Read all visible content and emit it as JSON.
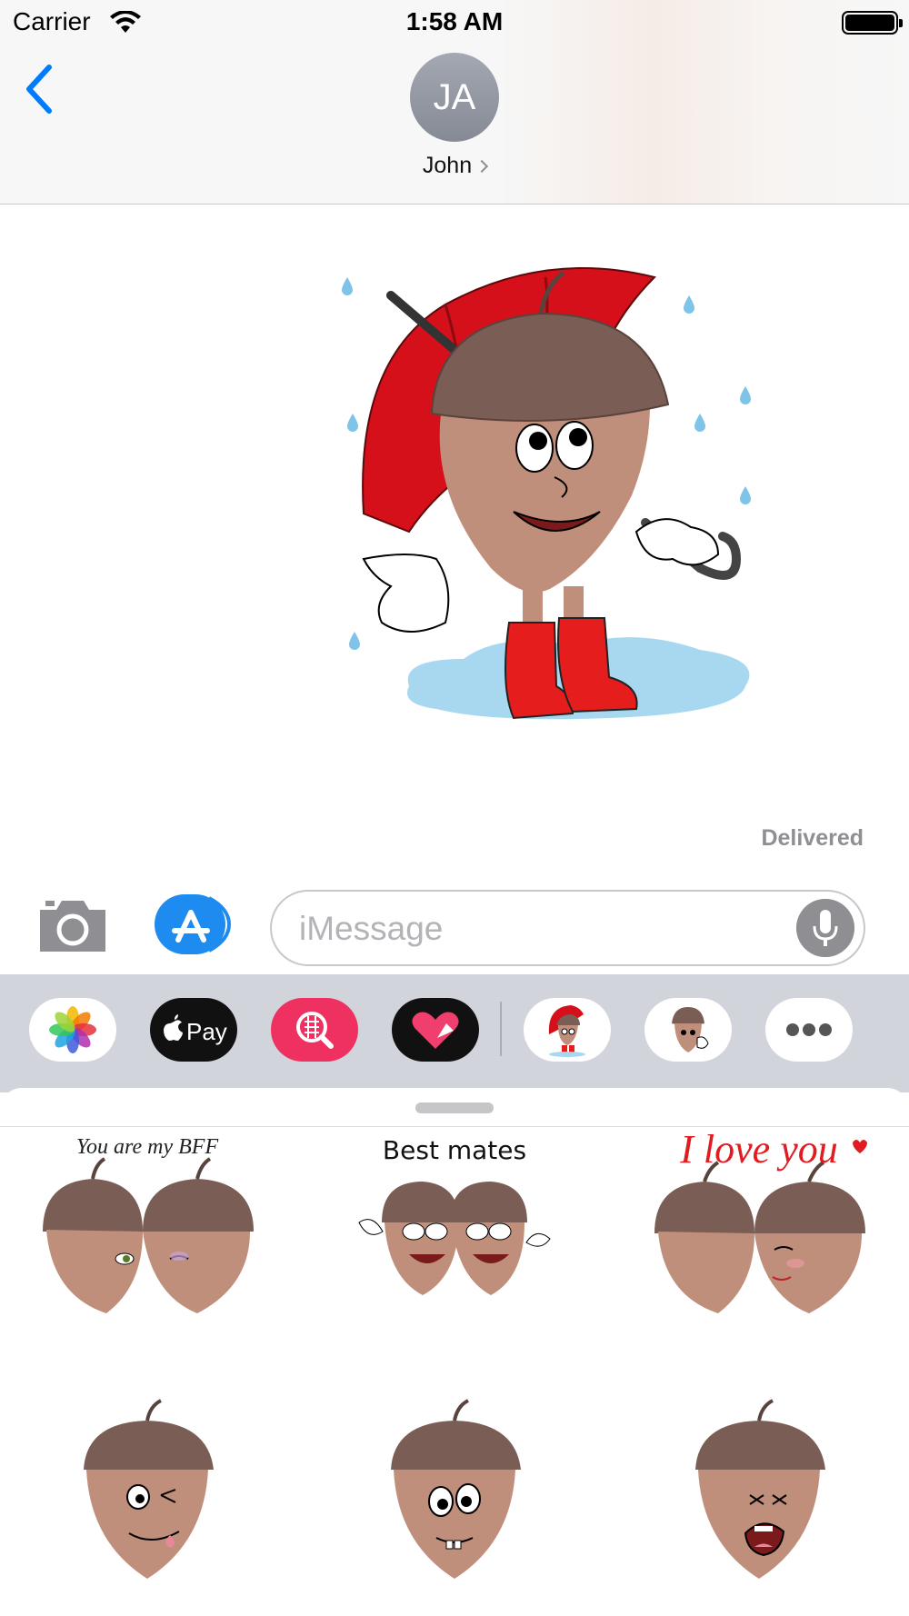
{
  "status_bar": {
    "carrier": "Carrier",
    "time": "1:58 AM"
  },
  "header": {
    "avatar_initials": "JA",
    "contact_name": "John"
  },
  "conversation": {
    "delivered_label": "Delivered"
  },
  "composer": {
    "placeholder": "iMessage"
  },
  "app_drawer": {
    "apps": [
      {
        "name": "Photos",
        "icon": "photos-icon"
      },
      {
        "name": "Apple Pay",
        "label": "Pay",
        "icon": "apple-pay-icon"
      },
      {
        "name": "Images search",
        "icon": "image-search-icon"
      },
      {
        "name": "Digital Touch",
        "icon": "digital-touch-icon"
      },
      {
        "name": "Acorn umbrella stickers",
        "icon": "acorn-umbrella-icon"
      },
      {
        "name": "Acorn stickers",
        "icon": "acorn-icon"
      },
      {
        "name": "More apps",
        "icon": "more-icon"
      }
    ]
  },
  "sticker_panel": {
    "stickers": [
      {
        "caption": "You are my BFF",
        "icon": "acorn-bff-sticker"
      },
      {
        "caption": "Best mates",
        "icon": "acorn-best-mates-sticker"
      },
      {
        "caption": "I love you",
        "icon": "acorn-love-sticker"
      },
      {
        "caption": "",
        "icon": "acorn-wink-sticker"
      },
      {
        "caption": "",
        "icon": "acorn-surprised-sticker"
      },
      {
        "caption": "",
        "icon": "acorn-crying-sticker"
      }
    ]
  },
  "colors": {
    "ios_blue": "#007aff",
    "umbrella_red": "#d6101a",
    "acorn_cap": "#7a5d55",
    "acorn_body": "#c08f7b",
    "love_red": "#e01b22"
  }
}
